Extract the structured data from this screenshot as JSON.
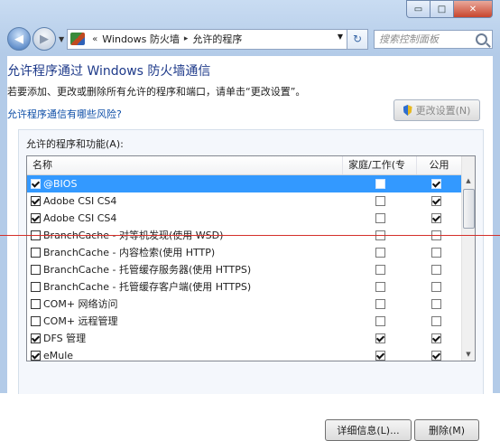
{
  "window_controls": {
    "minimize": "▭",
    "maximize": "□",
    "close": "✕"
  },
  "nav": {
    "back_icon": "◀",
    "forward_icon": "▶",
    "history_dropdown": "▼",
    "address": {
      "chevron": "«",
      "crumb1": "Windows 防火墙",
      "separator": "▸",
      "crumb2": "允许的程序",
      "dropdown": "▼"
    },
    "refresh_icon": "↻",
    "search_placeholder": "搜索控制面板"
  },
  "page": {
    "title": "允许程序通过 Windows 防火墙通信",
    "description": "若要添加、更改或删除所有允许的程序和端口，请单击“更改设置”。",
    "risk_link": "允许程序通信有哪些风险?",
    "change_settings_button": "更改设置(N)"
  },
  "list": {
    "group_label": "允许的程序和功能(A):",
    "columns": {
      "name": "名称",
      "home_work": "家庭/工作(专用)",
      "public": "公用"
    },
    "rows": [
      {
        "name": "@BIOS",
        "enabled": true,
        "home": false,
        "public": true,
        "selected": true
      },
      {
        "name": "Adobe CSI CS4",
        "enabled": true,
        "home": false,
        "public": true,
        "selected": false
      },
      {
        "name": "Adobe CSI CS4",
        "enabled": true,
        "home": false,
        "public": true,
        "selected": false
      },
      {
        "name": "BranchCache - 对等机发现(使用 WSD)",
        "enabled": false,
        "home": false,
        "public": false,
        "selected": false
      },
      {
        "name": "BranchCache - 内容检索(使用 HTTP)",
        "enabled": false,
        "home": false,
        "public": false,
        "selected": false
      },
      {
        "name": "BranchCache - 托管缓存服务器(使用 HTTPS)",
        "enabled": false,
        "home": false,
        "public": false,
        "selected": false
      },
      {
        "name": "BranchCache - 托管缓存客户端(使用 HTTPS)",
        "enabled": false,
        "home": false,
        "public": false,
        "selected": false
      },
      {
        "name": "COM+ 网络访问",
        "enabled": false,
        "home": false,
        "public": false,
        "selected": false
      },
      {
        "name": "COM+ 远程管理",
        "enabled": false,
        "home": false,
        "public": false,
        "selected": false
      },
      {
        "name": "DFS 管理",
        "enabled": true,
        "home": true,
        "public": true,
        "selected": false
      },
      {
        "name": "eMule",
        "enabled": true,
        "home": true,
        "public": true,
        "selected": false
      }
    ]
  },
  "buttons": {
    "details": "详细信息(L)...",
    "delete": "删除(M)"
  },
  "scrollbar": {
    "up": "▲",
    "down": "▼"
  },
  "colors": {
    "selection": "#3399ff",
    "title": "#1e3a8a",
    "link": "#0f4fa8",
    "red_line": "#d4302a"
  }
}
